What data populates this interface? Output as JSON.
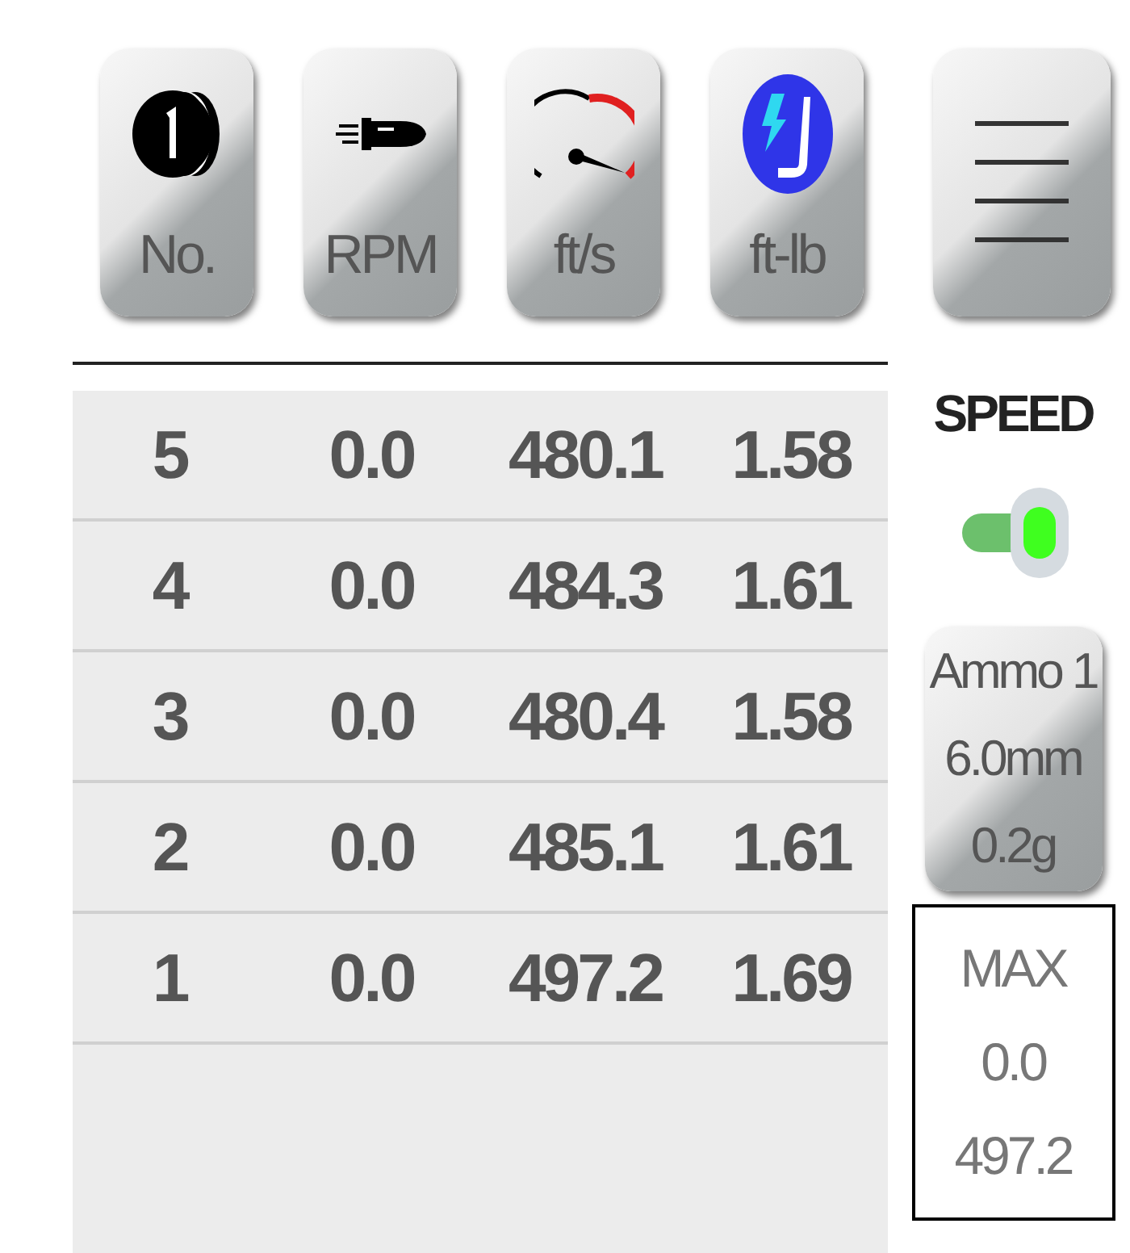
{
  "toolbar": [
    {
      "kind": "coin",
      "label": "No."
    },
    {
      "kind": "bullet",
      "label": "RPM"
    },
    {
      "kind": "gauge",
      "label": "ft/s"
    },
    {
      "kind": "energy",
      "label": "ft-lb"
    },
    {
      "kind": "menu"
    }
  ],
  "table": {
    "rows": [
      [
        "5",
        "0.0",
        "480.1",
        "1.58"
      ],
      [
        "4",
        "0.0",
        "484.3",
        "1.61"
      ],
      [
        "3",
        "0.0",
        "480.4",
        "1.58"
      ],
      [
        "2",
        "0.0",
        "485.1",
        "1.61"
      ],
      [
        "1",
        "0.0",
        "497.2",
        "1.69"
      ]
    ]
  },
  "speed": {
    "label": "SPEED",
    "on": true
  },
  "ammo": [
    "Ammo 1",
    "6.0mm",
    "0.2g"
  ],
  "max": [
    "MAX",
    "0.0",
    "497.2"
  ]
}
